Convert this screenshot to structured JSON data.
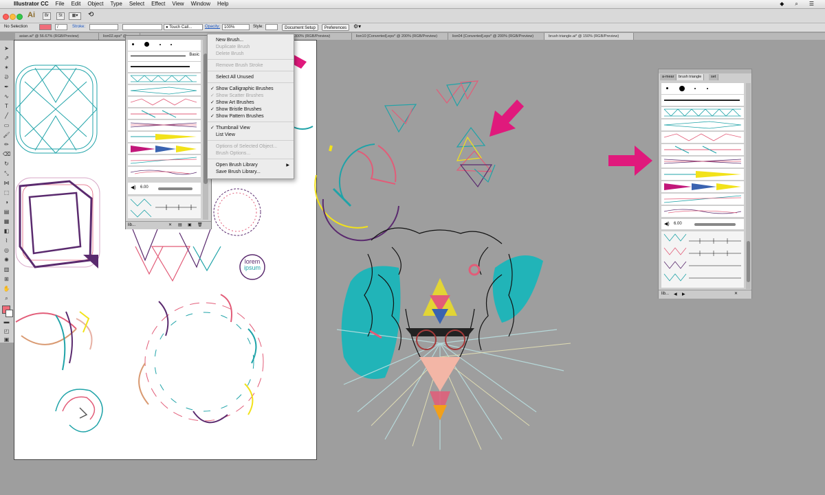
{
  "menu_bar": {
    "app_name": "Illustrator CC",
    "items": [
      "File",
      "Edit",
      "Object",
      "Type",
      "Select",
      "Effect",
      "View",
      "Window",
      "Help"
    ]
  },
  "app_bar": {
    "logo": "Ai"
  },
  "control_bar": {
    "selection": "No Selection",
    "stroke_label": "Stroke:",
    "brush_value": "Touch Call...",
    "opacity_label": "Opacity:",
    "opacity_value": "100%",
    "style_label": "Style:",
    "document_setup": "Document Setup",
    "preferences": "Preferences"
  },
  "tabs": [
    {
      "label": "asian.ai* @ 56.67% (RGB/Preview)"
    },
    {
      "label": "lion02.eps* @"
    },
    {
      "label": "300% (RGB/Preview)"
    },
    {
      "label": "lion10 [Converted].eps* @ 200% (RGB/Preview)"
    },
    {
      "label": "lion04 [Converted].eps* @ 200% (RGB/Preview)"
    },
    {
      "label": "brush triangle.ai* @ 150% (RGB/Preview)"
    }
  ],
  "brush_panel": {
    "basic_label": "Basic",
    "size_value": "6.00",
    "footer_label": "lib..."
  },
  "flyout_menu": {
    "items": [
      {
        "label": "New Brush...",
        "enabled": true,
        "checked": false
      },
      {
        "label": "Duplicate Brush",
        "enabled": false,
        "checked": false
      },
      {
        "label": "Delete Brush",
        "enabled": false,
        "checked": false
      },
      {
        "label": "Remove Brush Stroke",
        "enabled": false,
        "checked": false
      },
      {
        "label": "Select All Unused",
        "enabled": true,
        "checked": false
      },
      {
        "label": "Show Calligraphic Brushes",
        "enabled": true,
        "checked": true
      },
      {
        "label": "Show Scatter Brushes",
        "enabled": false,
        "checked": true
      },
      {
        "label": "Show Art Brushes",
        "enabled": true,
        "checked": true
      },
      {
        "label": "Show Bristle Brushes",
        "enabled": true,
        "checked": true
      },
      {
        "label": "Show Pattern Brushes",
        "enabled": true,
        "checked": true
      },
      {
        "label": "Thumbnail View",
        "enabled": true,
        "checked": true
      },
      {
        "label": "List View",
        "enabled": true,
        "checked": false
      },
      {
        "label": "Options of Selected Object...",
        "enabled": false,
        "checked": false
      },
      {
        "label": "Brush Options...",
        "enabled": false,
        "checked": false
      },
      {
        "label": "Open Brush Library",
        "enabled": true,
        "checked": false,
        "submenu": true
      },
      {
        "label": "Save Brush Library...",
        "enabled": true,
        "checked": false
      }
    ]
  },
  "right_panel": {
    "tabs": [
      "a-mear",
      "brush triangle",
      "set"
    ],
    "active_tab": "brush triangle",
    "size_value": "6.00",
    "footer_label": "lib..."
  },
  "artboard": {
    "logo_line1": "lorem",
    "logo_line2": "ipsum"
  },
  "colors": {
    "accent_arrow": "#e0197c",
    "teal": "#1fa3a8",
    "pink": "#e25c78",
    "yellow": "#f2e21a",
    "purple": "#5a2a6e"
  }
}
